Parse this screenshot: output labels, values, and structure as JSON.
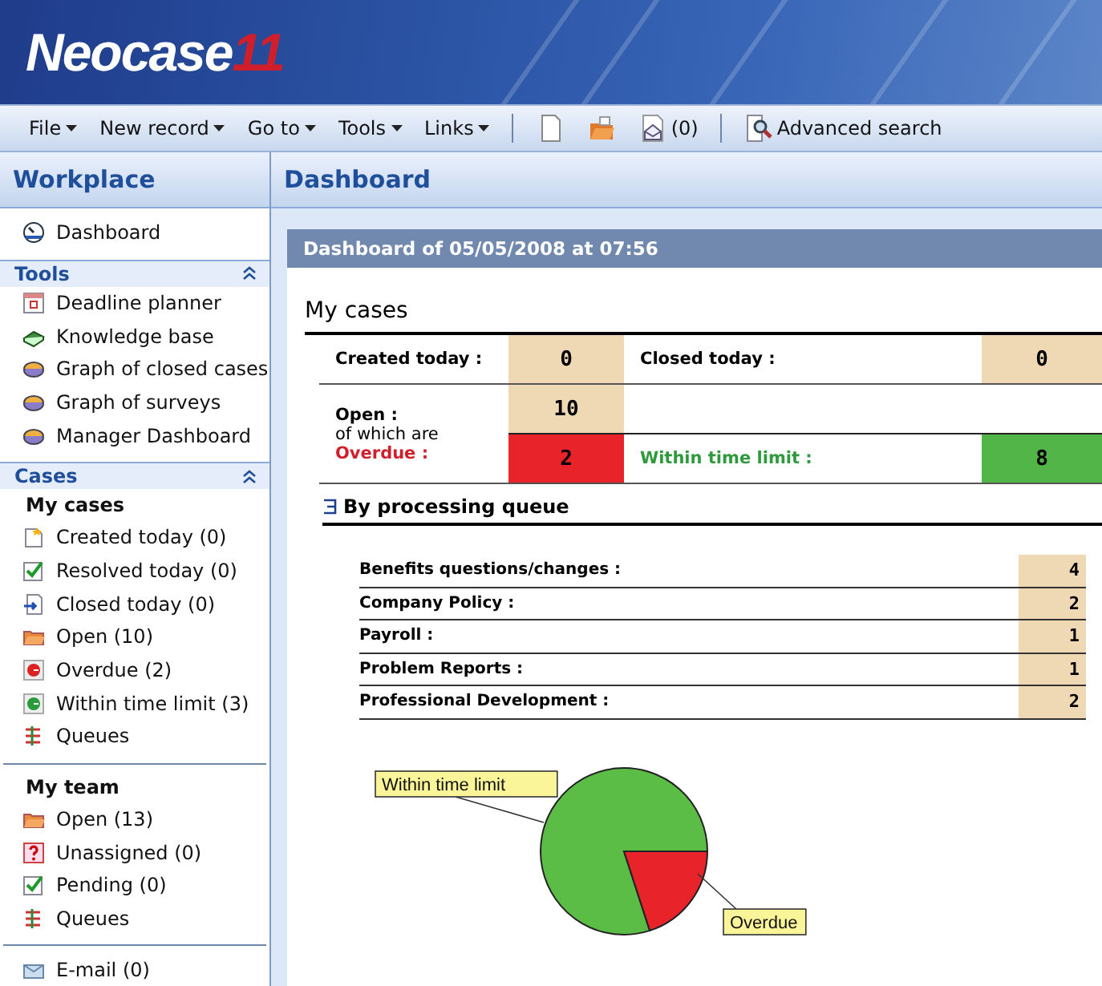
{
  "logo": {
    "name": "Neocase",
    "version": "11"
  },
  "menu": [
    {
      "label": "File"
    },
    {
      "label": "New record"
    },
    {
      "label": "Go to"
    },
    {
      "label": "Tools"
    },
    {
      "label": "Links"
    }
  ],
  "toolbar": [
    {
      "kind": "new",
      "separator": true
    },
    {
      "kind": "open",
      "separator": false
    },
    {
      "kind": "mail",
      "label": "(0)",
      "separator": false
    },
    {
      "kind": "search",
      "label": "Advanced search",
      "separator": true
    }
  ],
  "sidebar": {
    "title": "Workplace",
    "top_items": [
      {
        "label": "Dashboard",
        "kind": "dashboard"
      }
    ],
    "sections": [
      {
        "title": "Tools",
        "expanded": true,
        "groups": [
          {
            "items": [
              {
                "label": "Deadline planner",
                "kind": "calendar"
              },
              {
                "label": "Knowledge base",
                "kind": "book"
              },
              {
                "label": "Graph of closed cases",
                "kind": "graph"
              },
              {
                "label": "Graph of surveys",
                "kind": "graph"
              },
              {
                "label": "Manager Dashboard",
                "kind": "graph"
              }
            ]
          }
        ]
      },
      {
        "title": "Cases",
        "expanded": true,
        "groups": [
          {
            "title": "My cases",
            "items": [
              {
                "label": "Created today (0)",
                "kind": "new"
              },
              {
                "label": "Resolved today (0)",
                "kind": "check"
              },
              {
                "label": "Closed today (0)",
                "kind": "closed"
              },
              {
                "label": "Open (10)",
                "kind": "folder"
              },
              {
                "label": "Overdue (2)",
                "kind": "overdue"
              },
              {
                "label": "Within time limit (3)",
                "kind": "within"
              },
              {
                "label": "Queues",
                "kind": "queues"
              }
            ]
          },
          {
            "title": "My team",
            "items": [
              {
                "label": "Open (13)",
                "kind": "folder"
              },
              {
                "label": "Unassigned (0)",
                "kind": "question"
              },
              {
                "label": "Pending (0)",
                "kind": "check"
              },
              {
                "label": "Queues",
                "kind": "queues"
              }
            ]
          }
        ]
      }
    ],
    "bottom_items": [
      {
        "label": "E-mail (0)",
        "kind": "email"
      }
    ]
  },
  "main": {
    "title": "Dashboard",
    "banner": "Dashboard of 05/05/2008 at 07:56",
    "my_cases": {
      "title": "My cases",
      "created_today": {
        "label": "Created today :",
        "value": "0"
      },
      "closed_today": {
        "label": "Closed today :",
        "value": "0"
      },
      "open": {
        "label": "Open :",
        "value": "10",
        "note": "of which are"
      },
      "overdue": {
        "label": "Overdue :",
        "value": "2"
      },
      "within_time_limit": {
        "label": "Within time limit :",
        "value": "8"
      }
    },
    "queue": {
      "title": "By processing queue",
      "expanded": true,
      "rows": [
        {
          "label": "Benefits questions/changes :",
          "value": "4"
        },
        {
          "label": "Company Policy :",
          "value": "2"
        },
        {
          "label": "Payroll :",
          "value": "1"
        },
        {
          "label": "Problem Reports :",
          "value": "1"
        },
        {
          "label": "Professional Development :",
          "value": "2"
        }
      ]
    },
    "chart_data": {
      "type": "pie",
      "categories": [
        "Within time limit",
        "Overdue"
      ],
      "values": [
        80,
        20
      ]
    }
  }
}
